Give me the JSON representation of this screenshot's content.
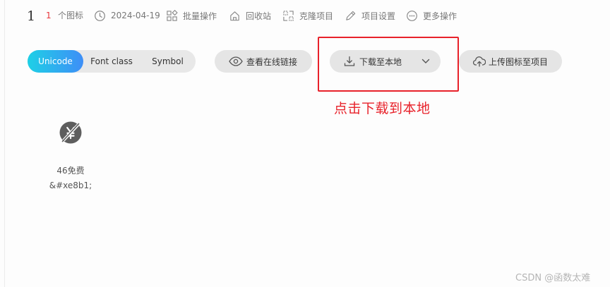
{
  "project": {
    "name": "1",
    "icon_count": "1",
    "icon_count_label": "个图标",
    "date": "2024-04-19"
  },
  "info_actions": {
    "batch": "批量操作",
    "recycle": "回收站",
    "clone": "克隆项目",
    "settings": "项目设置",
    "more": "更多操作"
  },
  "tabs": [
    {
      "label": "Unicode",
      "active": true
    },
    {
      "label": "Font class",
      "active": false
    },
    {
      "label": "Symbol",
      "active": false
    }
  ],
  "toolbar": {
    "view_online_link": "查看在线链接",
    "download_local": "下载至本地",
    "upload_to_project": "上传图标至项目"
  },
  "annotation": {
    "text": "点击下载到本地",
    "color": "#e8212a"
  },
  "icons": [
    {
      "name": "46免费",
      "code": "&#xe8b1;",
      "icon": "free-yen-icon"
    }
  ],
  "colors": {
    "accent_start": "#1ed0e6",
    "accent_end": "#3e8ef7",
    "count_red": "#e8363b"
  },
  "watermark": "CSDN @函数太难"
}
